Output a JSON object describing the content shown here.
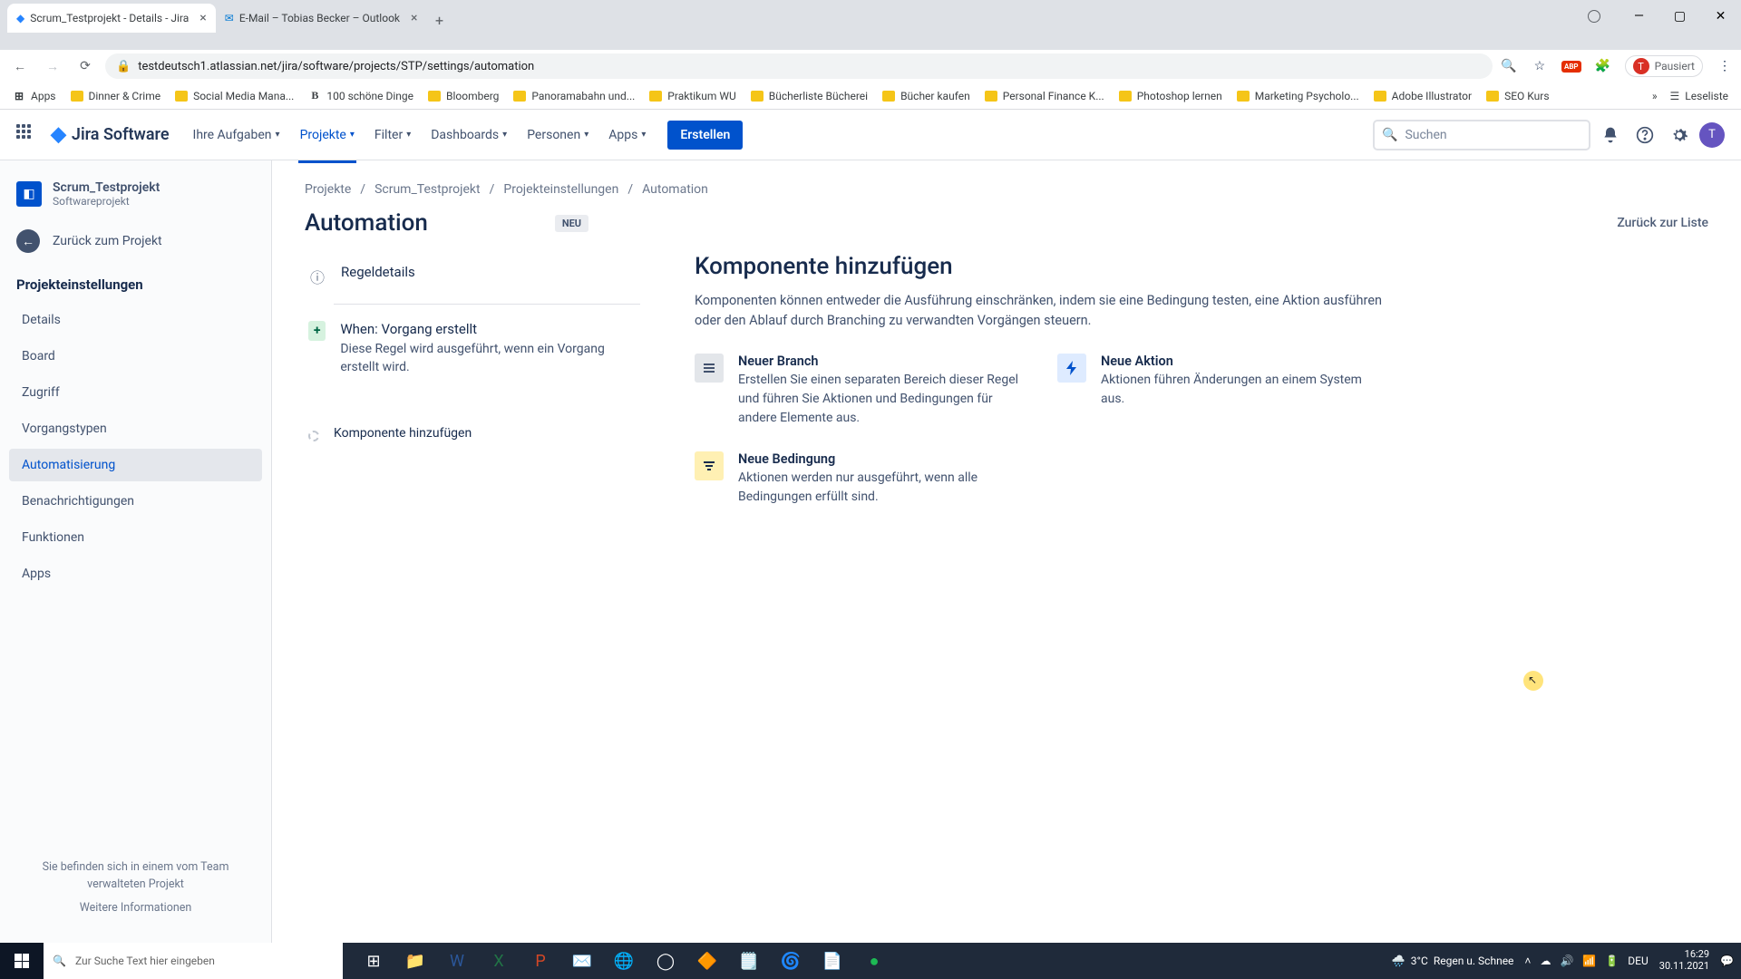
{
  "browser": {
    "tabs": [
      {
        "title": "Scrum_Testprojekt - Details - Jira",
        "icon": "jira"
      },
      {
        "title": "E-Mail – Tobias Becker – Outlook",
        "icon": "outlook"
      }
    ],
    "url": "testdeutsch1.atlassian.net/jira/software/projects/STP/settings/automation",
    "pause_label": "Pausiert",
    "bookmarks": [
      {
        "label": "Apps",
        "type": "apps"
      },
      {
        "label": "Dinner & Crime",
        "type": "folder"
      },
      {
        "label": "Social Media Mana...",
        "type": "folder"
      },
      {
        "label": "100 schöne Dinge",
        "type": "site",
        "initial": "B"
      },
      {
        "label": "Bloomberg",
        "type": "folder"
      },
      {
        "label": "Panoramabahn und...",
        "type": "folder"
      },
      {
        "label": "Praktikum WU",
        "type": "folder"
      },
      {
        "label": "Bücherliste Bücherei",
        "type": "folder"
      },
      {
        "label": "Bücher kaufen",
        "type": "folder"
      },
      {
        "label": "Personal Finance K...",
        "type": "folder"
      },
      {
        "label": "Photoshop lernen",
        "type": "folder"
      },
      {
        "label": "Marketing Psycholo...",
        "type": "folder"
      },
      {
        "label": "Adobe Illustrator",
        "type": "folder"
      },
      {
        "label": "SEO Kurs",
        "type": "folder"
      }
    ],
    "reading_list": "Leseliste"
  },
  "jira_nav": {
    "product": "Jira Software",
    "items": [
      "Ihre Aufgaben",
      "Projekte",
      "Filter",
      "Dashboards",
      "Personen",
      "Apps"
    ],
    "active_index": 1,
    "create": "Erstellen",
    "search_placeholder": "Suchen",
    "user_initial": "T"
  },
  "sidebar": {
    "project_name": "Scrum_Testprojekt",
    "project_sub": "Softwareprojekt",
    "back": "Zurück zum Projekt",
    "section": "Projekteinstellungen",
    "items": [
      "Details",
      "Board",
      "Zugriff",
      "Vorgangstypen",
      "Automatisierung",
      "Benachrichtigungen",
      "Funktionen",
      "Apps"
    ],
    "active_index": 4,
    "footer_line": "Sie befinden sich in einem vom Team verwalteten Projekt",
    "footer_link": "Weitere Informationen"
  },
  "breadcrumb": [
    "Projekte",
    "Scrum_Testprojekt",
    "Projekteinstellungen",
    "Automation"
  ],
  "page": {
    "title": "Automation",
    "badge": "NEU",
    "back_link": "Zurück zur Liste"
  },
  "rule_chain": {
    "details": "Regeldetails",
    "trigger_title": "When: Vorgang erstellt",
    "trigger_desc": "Diese Regel wird ausgeführt, wenn ein Vorgang erstellt wird.",
    "add_component": "Komponente hinzufügen"
  },
  "panel": {
    "title": "Komponente hinzufügen",
    "desc": "Komponenten können entweder die Ausführung einschränken, indem sie eine Bedingung testen, eine Aktion ausführen oder den Ablauf durch Branching zu verwandten Vorgängen steuern.",
    "cards": [
      {
        "title": "Neuer Branch",
        "desc": "Erstellen Sie einen separaten Bereich dieser Regel und führen Sie Aktionen und Bedingungen für andere Elemente aus."
      },
      {
        "title": "Neue Aktion",
        "desc": "Aktionen führen Änderungen an einem System aus."
      },
      {
        "title": "Neue Bedingung",
        "desc": "Aktionen werden nur ausgeführt, wenn alle Bedingungen erfüllt sind."
      }
    ]
  },
  "taskbar": {
    "search_placeholder": "Zur Suche Text hier eingeben",
    "weather_temp": "3°C",
    "weather_text": "Regen u. Schnee",
    "lang": "DEU",
    "time": "16:29",
    "date": "30.11.2021"
  }
}
